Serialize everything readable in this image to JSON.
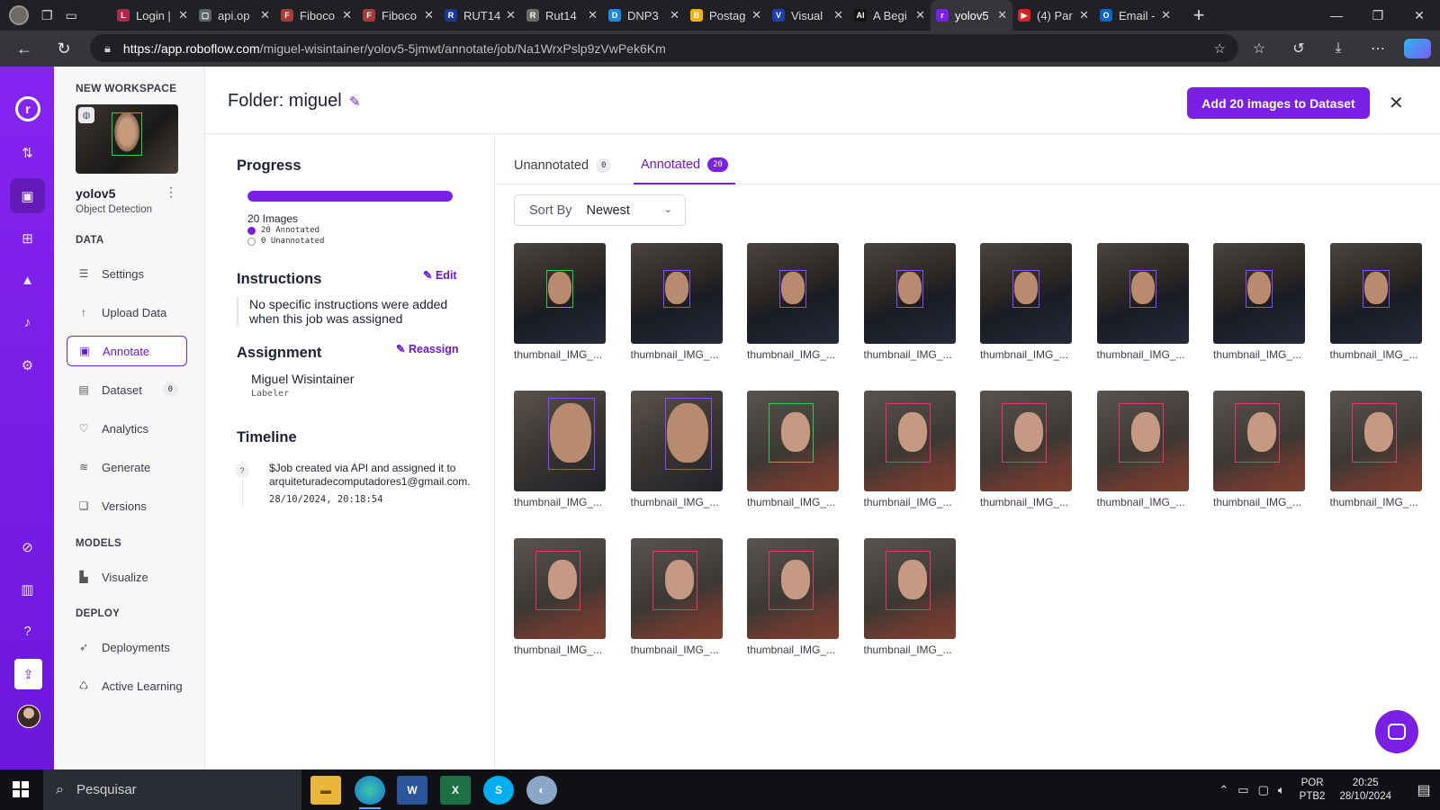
{
  "browser": {
    "tabs": [
      {
        "title": "Login |",
        "color": "#b0294a",
        "icon": "L"
      },
      {
        "title": "api.op",
        "color": "#5f6368",
        "icon": "▢"
      },
      {
        "title": "Fiboco",
        "color": "#a83a3a",
        "icon": "F"
      },
      {
        "title": "Fiboco",
        "color": "#a83a3a",
        "icon": "F"
      },
      {
        "title": "RUT14",
        "color": "#1a3a8f",
        "icon": "R"
      },
      {
        "title": "Rut14",
        "color": "#6a6a6a",
        "icon": "R"
      },
      {
        "title": "DNP3",
        "color": "#1e88e5",
        "icon": "D"
      },
      {
        "title": "Postag",
        "color": "#f4b400",
        "icon": "B"
      },
      {
        "title": "Visual",
        "color": "#1e40af",
        "icon": "V"
      },
      {
        "title": "A Begi",
        "color": "#111111",
        "icon": "AI"
      },
      {
        "title": "yolov5",
        "color": "#7a1fe6",
        "icon": "r",
        "active": true
      },
      {
        "title": "(4) Par",
        "color": "#e02020",
        "icon": "▶"
      },
      {
        "title": "Email -",
        "color": "#0a66c2",
        "icon": "O"
      }
    ],
    "url_host": "https://app.roboflow.com",
    "url_path": "/miguel-wisintainer/yolov5-5jmwt/annotate/job/Na1WrxPslp9zVwPek6Km"
  },
  "sidebar": {
    "workspace_label": "NEW WORKSPACE",
    "project_name": "yolov5",
    "project_type": "Object Detection",
    "data_section": "DATA",
    "models_section": "MODELS",
    "deploy_section": "DEPLOY",
    "items": [
      {
        "label": "Settings",
        "icon": "list-icon"
      },
      {
        "label": "Upload Data",
        "icon": "upload-icon"
      },
      {
        "label": "Annotate",
        "icon": "annotate-icon",
        "active": true
      },
      {
        "label": "Dataset",
        "icon": "dataset-icon",
        "count": "0"
      },
      {
        "label": "Analytics",
        "icon": "analytics-icon"
      },
      {
        "label": "Generate",
        "icon": "generate-icon"
      },
      {
        "label": "Versions",
        "icon": "versions-icon"
      },
      {
        "label": "Visualize",
        "icon": "visualize-icon"
      },
      {
        "label": "Deployments",
        "icon": "rocket-icon"
      },
      {
        "label": "Active Learning",
        "icon": "recycle-icon"
      }
    ]
  },
  "header": {
    "title": "Folder: miguel",
    "add_button": "Add 20 images to Dataset"
  },
  "progress": {
    "heading": "Progress",
    "fraction_annotated": 1.0,
    "image_count_text": "20 Images",
    "annotated_text": "20 Annotated",
    "unannotated_text": "0 Unannotated"
  },
  "instructions": {
    "heading": "Instructions",
    "edit_label": "Edit",
    "text": "No specific instructions were added when this job was assigned"
  },
  "assignment": {
    "heading": "Assignment",
    "reassign_label": "Reassign",
    "assignee": "Miguel Wisintainer",
    "role": "Labeler"
  },
  "timeline": {
    "heading": "Timeline",
    "event_text": "$Job created via API and assigned it to arquiteturadecomputadores1@gmail.com.",
    "event_date": "28/10/2024, 20:18:54",
    "icon_text": "?"
  },
  "tabs": {
    "unannotated_label": "Unannotated",
    "unannotated_count": "0",
    "annotated_label": "Annotated",
    "annotated_count": "20"
  },
  "sort": {
    "label": "Sort By",
    "value": "Newest"
  },
  "images": [
    {
      "label": "thumbnail_IMG_...",
      "subject": "man",
      "box_color": "#27d24a"
    },
    {
      "label": "thumbnail_IMG_...",
      "subject": "man",
      "box_color": "#8a4bff"
    },
    {
      "label": "thumbnail_IMG_...",
      "subject": "man",
      "box_color": "#8a4bff"
    },
    {
      "label": "thumbnail_IMG_...",
      "subject": "man",
      "box_color": "#8a4bff"
    },
    {
      "label": "thumbnail_IMG_...",
      "subject": "man",
      "box_color": "#8a4bff"
    },
    {
      "label": "thumbnail_IMG_...",
      "subject": "man",
      "box_color": "#8a4bff"
    },
    {
      "label": "thumbnail_IMG_...",
      "subject": "man",
      "box_color": "#8a4bff"
    },
    {
      "label": "thumbnail_IMG_...",
      "subject": "man",
      "box_color": "#8a4bff"
    },
    {
      "label": "thumbnail_IMG_...",
      "subject": "man-close",
      "box_color": "#8a4bff"
    },
    {
      "label": "thumbnail_IMG_...",
      "subject": "man-close",
      "box_color": "#8a4bff"
    },
    {
      "label": "thumbnail_IMG_...",
      "subject": "woman",
      "box_color": "#27d24a"
    },
    {
      "label": "thumbnail_IMG_...",
      "subject": "woman",
      "box_color": "#e8336b"
    },
    {
      "label": "thumbnail_IMG_...",
      "subject": "woman",
      "box_color": "#e8336b"
    },
    {
      "label": "thumbnail_IMG_...",
      "subject": "woman",
      "box_color": "#e8336b"
    },
    {
      "label": "thumbnail_IMG_...",
      "subject": "woman",
      "box_color": "#e8336b"
    },
    {
      "label": "thumbnail_IMG_...",
      "subject": "woman",
      "box_color": "#e8336b"
    },
    {
      "label": "thumbnail_IMG_...",
      "subject": "woman",
      "box_color": "#e8336b"
    },
    {
      "label": "thumbnail_IMG_...",
      "subject": "woman",
      "box_color": "#e8336b"
    },
    {
      "label": "thumbnail_IMG_...",
      "subject": "woman",
      "box_color": "#e8336b"
    },
    {
      "label": "thumbnail_IMG_...",
      "subject": "woman",
      "box_color": "#e8336b"
    }
  ],
  "taskbar": {
    "search_placeholder": "Pesquisar",
    "lang_line1": "POR",
    "lang_line2": "PTB2",
    "time": "20:25",
    "date": "28/10/2024"
  },
  "colors": {
    "brand": "#7a1fe6"
  }
}
